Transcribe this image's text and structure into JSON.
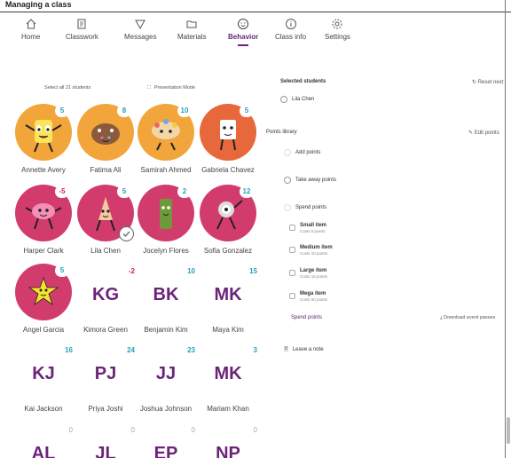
{
  "window": {
    "title": "Managing a class"
  },
  "nav": [
    {
      "label": "Home",
      "icon": "home-icon"
    },
    {
      "label": "Classwork",
      "icon": "classwork-icon"
    },
    {
      "label": "Messages",
      "icon": "messages-icon"
    },
    {
      "label": "Materials",
      "icon": "folder-icon"
    },
    {
      "label": "Behavior",
      "icon": "smiley-icon",
      "active": true
    },
    {
      "label": "Class info",
      "icon": "info-icon"
    },
    {
      "label": "Settings",
      "icon": "gear-icon"
    }
  ],
  "toolbar": {
    "select_all": "Select all 21 students",
    "presentation": "Presentation Mode"
  },
  "students": [
    {
      "name": "Annette Avery",
      "points": "5",
      "color": "#2aa0b8"
    },
    {
      "name": "Fatima Ali",
      "points": "8",
      "color": "#2aa0b8"
    },
    {
      "name": "Samirah Ahmed",
      "points": "10",
      "color": "#2aa0b8"
    },
    {
      "name": "Gabriela Chavez",
      "points": "5",
      "color": "#2aa0b8"
    },
    {
      "name": "Harper Clark",
      "points": "-5",
      "color": "#d0284a"
    },
    {
      "name": "Lila Chen",
      "points": "5",
      "color": "#2aa0b8",
      "selected": true
    },
    {
      "name": "Jocelyn Flores",
      "points": "2",
      "color": "#2aa0b8"
    },
    {
      "name": "Sofia Gonzalez",
      "points": "12",
      "color": "#2aa0b8"
    },
    {
      "name": "Angel Garcia",
      "points": "5",
      "color": "#2aa0b8"
    },
    {
      "name": "Kimora Green",
      "initials": "KG",
      "points": "-2"
    },
    {
      "name": "Benjamin Kim",
      "initials": "BK",
      "points": "10"
    },
    {
      "name": "Maya Kim",
      "initials": "MK",
      "points": "15"
    },
    {
      "name": "Kai Jackson",
      "initials": "KJ",
      "points": "16"
    },
    {
      "name": "Priya Joshi",
      "initials": "PJ",
      "points": "24"
    },
    {
      "name": "Joshua Johnson",
      "initials": "JJ",
      "points": "23"
    },
    {
      "name": "Mariam Khan",
      "initials": "MK",
      "points": "3"
    },
    {
      "initials": "AL",
      "points": "0"
    },
    {
      "initials": "JL",
      "points": "0"
    },
    {
      "initials": "EP",
      "points": "0"
    },
    {
      "initials": "NP",
      "points": "0"
    }
  ],
  "panel": {
    "selected_heading": "Selected students",
    "reset_label": "Reset next",
    "selected_student": "Lila Chen",
    "library_heading": "Points library",
    "edit_label": "Edit points",
    "add_points": "Add points",
    "take_away": "Take away points",
    "spend_points": "Spend points",
    "items": [
      {
        "title": "Small item",
        "sub": "Costs 5 points"
      },
      {
        "title": "Medium item",
        "sub": "Costs 10 points"
      },
      {
        "title": "Large item",
        "sub": "Costs 15 points"
      },
      {
        "title": "Mega item",
        "sub": "Costs 50 points"
      }
    ],
    "spend_link": "Spend points",
    "download_link": "Download event passes",
    "leave_note": "Leave a note"
  },
  "colors": {
    "accent": "#6b2478",
    "positive": "#2aa0b8",
    "negative": "#d0284a"
  }
}
